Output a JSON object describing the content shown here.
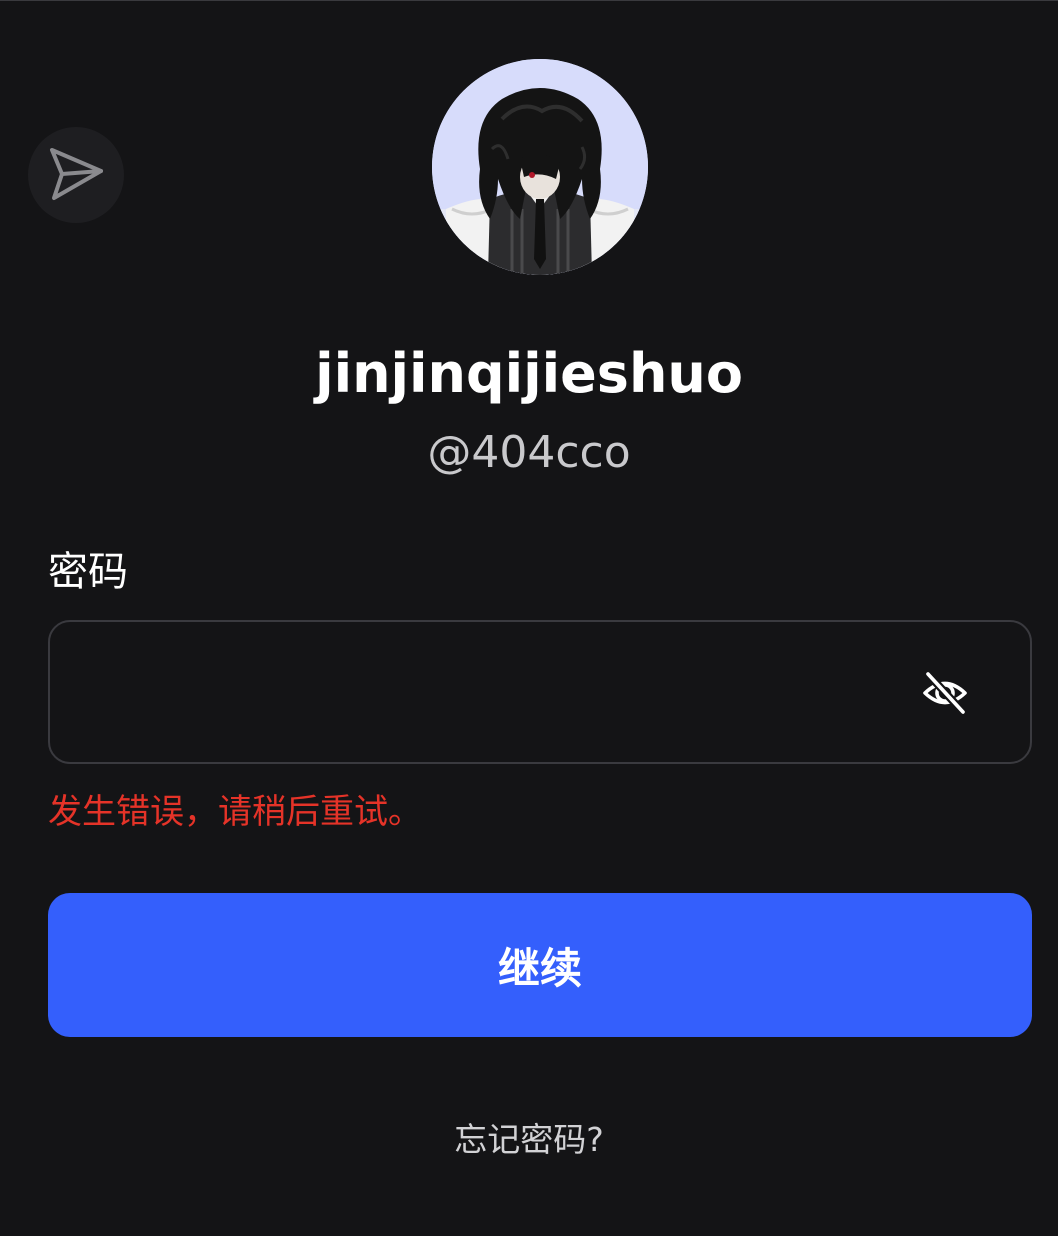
{
  "profile": {
    "display_name": "jinjinqijieshuo",
    "handle": "@404cco"
  },
  "form": {
    "password_label": "密码",
    "password_value": "",
    "error_message": "发生错误，请稍后重试。",
    "continue_label": "继续",
    "forgot_password_label": "忘记密码?"
  },
  "icons": {
    "share": "send-icon",
    "visibility": "eye-off-icon"
  },
  "colors": {
    "background": "#141416",
    "accent": "#345ffc",
    "error": "#e53328",
    "field_border": "#3a3a3f"
  }
}
